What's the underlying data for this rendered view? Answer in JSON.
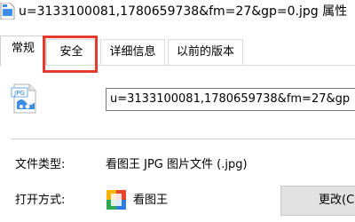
{
  "window": {
    "title": "u=3133100081,1780659738&fm=27&gp=0.jpg 属性"
  },
  "tabs": [
    {
      "label": "常规"
    },
    {
      "label": "安全"
    },
    {
      "label": "详细信息"
    },
    {
      "label": "以前的版本"
    }
  ],
  "general": {
    "file_icon_label": "JPG",
    "file_name_value": "u=3133100081,1780659738&fm=27&gp",
    "file_type_label": "文件类型:",
    "file_type_value": "看图王 JPG 图片文件 (.jpg)",
    "open_with_label": "打开方式:",
    "open_with_app": "看图王",
    "change_button_label": "更改(C"
  },
  "colors": {
    "highlight_red": "#e33b2e",
    "button_face": "#e1e1e1",
    "border_gray": "#d9d9d9"
  }
}
